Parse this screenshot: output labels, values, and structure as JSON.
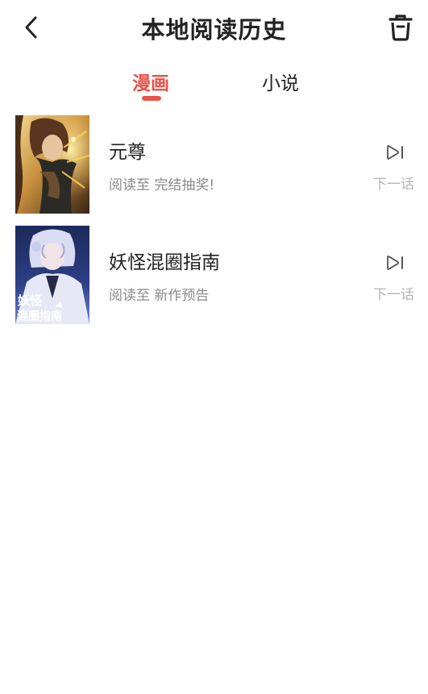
{
  "header": {
    "title": "本地阅读历史",
    "back_icon": "chevron-left-icon",
    "trash_icon": "trash-icon"
  },
  "tabs": [
    {
      "label": "漫画",
      "active": true
    },
    {
      "label": "小说",
      "active": false
    }
  ],
  "colors": {
    "accent": "#e8524a",
    "text_primary": "#222222",
    "text_secondary": "#8a8a8a",
    "text_muted": "#b4b4b4"
  },
  "history": [
    {
      "title": "元尊",
      "progress": "阅读至 完结抽奖!",
      "next_icon": "play-next-icon",
      "next_label": "下一话"
    },
    {
      "title": "妖怪混圈指南",
      "progress": "阅读至 新作预告",
      "next_icon": "play-next-icon",
      "next_label": "下一话",
      "cover_text_line1": "妖怪",
      "cover_text_line2": "混圈指南"
    }
  ]
}
